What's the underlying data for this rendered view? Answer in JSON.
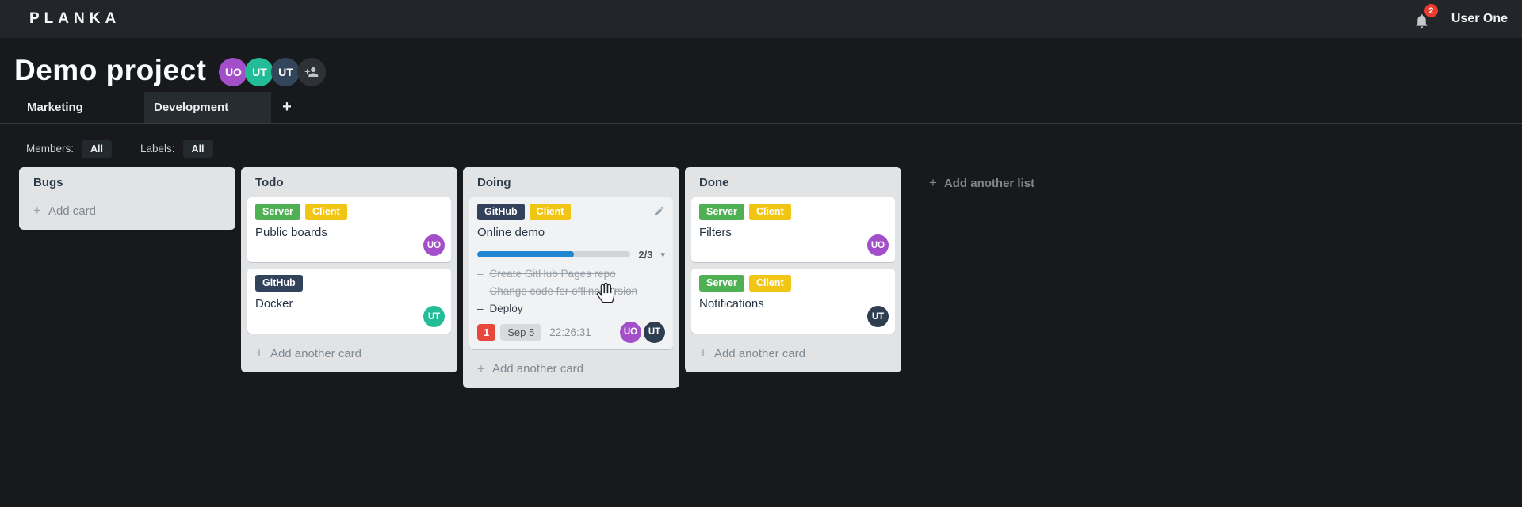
{
  "icons": {
    "plus": "+",
    "chevron_down": "▾",
    "task_bullet": "–"
  },
  "topbar": {
    "logo": "PLANKA",
    "notifications_count": "2",
    "user_name": "User One"
  },
  "project": {
    "title": "Demo project",
    "members": [
      {
        "initials": "UO",
        "color": "#a34fc9"
      },
      {
        "initials": "UT",
        "color": "#22bd96"
      },
      {
        "initials": "UT",
        "color": "#33455a"
      }
    ]
  },
  "tabs": [
    {
      "label": "Marketing"
    },
    {
      "label": "Development"
    }
  ],
  "filters": {
    "members_label": "Members:",
    "members_value": "All",
    "labels_label": "Labels:",
    "labels_value": "All"
  },
  "board": {
    "add_list_label": "Add another list",
    "lists": [
      {
        "title": "Bugs",
        "add_label": "Add card",
        "cards": []
      },
      {
        "title": "Todo",
        "add_label": "Add another card",
        "cards": [
          {
            "title": "Public boards",
            "labels": [
              {
                "text": "Server",
                "color": "#4fb054"
              },
              {
                "text": "Client",
                "color": "#f0c514"
              }
            ],
            "members": [
              {
                "initials": "UO",
                "color": "#a34fc9"
              }
            ]
          },
          {
            "title": "Docker",
            "labels": [
              {
                "text": "GitHub",
                "color": "#31425a"
              }
            ],
            "members": [
              {
                "initials": "UT",
                "color": "#22bd96"
              }
            ]
          }
        ]
      },
      {
        "title": "Doing",
        "add_label": "Add another card",
        "cards": [
          {
            "title": "Online demo",
            "labels": [
              {
                "text": "GitHub",
                "color": "#31425a"
              },
              {
                "text": "Client",
                "color": "#f0c514"
              }
            ],
            "progress": {
              "label": "2/3",
              "percent": 63
            },
            "tasks": [
              {
                "text": "Create GitHub Pages repo",
                "completed": true
              },
              {
                "text": "Change code for offline version",
                "completed": true
              },
              {
                "text": "Deploy",
                "completed": false
              }
            ],
            "notification_count": "1",
            "due_date": "Sep 5",
            "timer": "22:26:31",
            "members": [
              {
                "initials": "UO",
                "color": "#a34fc9"
              },
              {
                "initials": "UT",
                "color": "#2e3d4f"
              }
            ]
          }
        ]
      },
      {
        "title": "Done",
        "add_label": "Add another card",
        "cards": [
          {
            "title": "Filters",
            "labels": [
              {
                "text": "Server",
                "color": "#4fb054"
              },
              {
                "text": "Client",
                "color": "#f0c514"
              }
            ],
            "members": [
              {
                "initials": "UO",
                "color": "#a34fc9"
              }
            ]
          },
          {
            "title": "Notifications",
            "labels": [
              {
                "text": "Server",
                "color": "#4fb054"
              },
              {
                "text": "Client",
                "color": "#f0c514"
              }
            ],
            "members": [
              {
                "initials": "UT",
                "color": "#2e3d4f"
              }
            ]
          }
        ]
      }
    ]
  }
}
